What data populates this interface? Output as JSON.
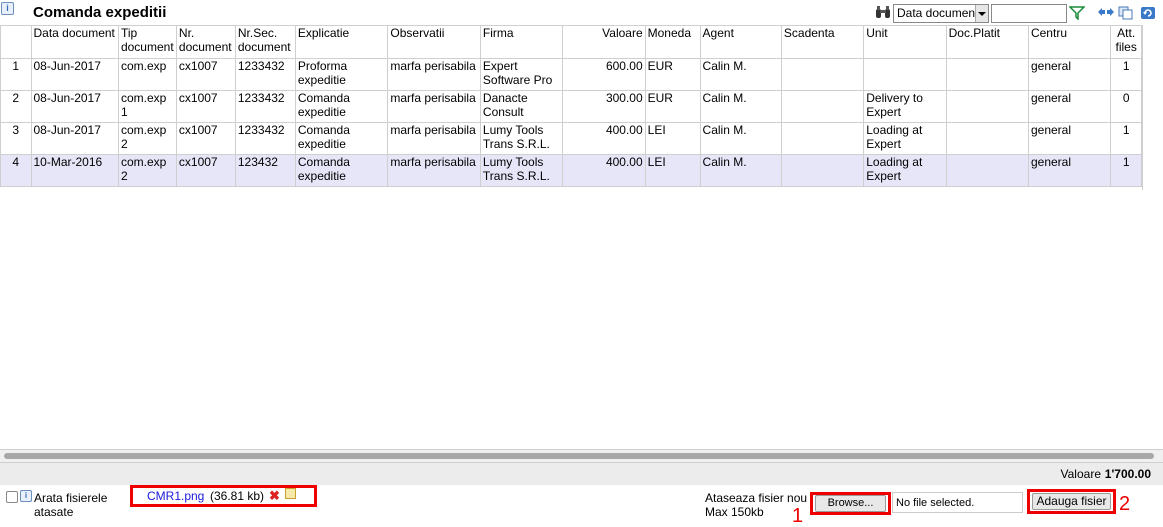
{
  "window": {
    "title": "Comanda expeditii"
  },
  "toolbar": {
    "sort_select_value": "Data documen",
    "search_value": "",
    "icons": [
      "binoculars-icon",
      "filter-icon",
      "expand-icon",
      "copy-icon",
      "refresh-icon"
    ]
  },
  "grid": {
    "columns": [
      {
        "label": "Data document"
      },
      {
        "label": "Tip document"
      },
      {
        "label": "Nr. document"
      },
      {
        "label": "Nr.Sec. document"
      },
      {
        "label": "Explicatie"
      },
      {
        "label": "Observatii"
      },
      {
        "label": "Firma"
      },
      {
        "label": "Valoare"
      },
      {
        "label": "Moneda"
      },
      {
        "label": "Agent"
      },
      {
        "label": "Scadenta"
      },
      {
        "label": "Unit"
      },
      {
        "label": "Doc.Platit"
      },
      {
        "label": "Centru"
      },
      {
        "label": "Att. files"
      }
    ],
    "rows": [
      {
        "n": "1",
        "data": "08-Jun-2017",
        "tip": "com.exp",
        "nr": "cx1007",
        "nrsec": "1233432",
        "explicatie": "Proforma expeditie",
        "observatii": "marfa perisabila",
        "firma": "Expert Software Pro",
        "valoare": "600.00",
        "moneda": "EUR",
        "agent": "Calin M.",
        "scadenta": "",
        "unit": "",
        "docplatit": "",
        "centru": "general",
        "att": "1"
      },
      {
        "n": "2",
        "data": "08-Jun-2017",
        "tip": "com.exp 1",
        "nr": "cx1007",
        "nrsec": "1233432",
        "explicatie": "Comanda expeditie",
        "observatii": "marfa perisabila",
        "firma": "Danacte Consult",
        "valoare": "300.00",
        "moneda": "EUR",
        "agent": "Calin M.",
        "scadenta": "",
        "unit": "Delivery to Expert",
        "docplatit": "",
        "centru": "general",
        "att": "0"
      },
      {
        "n": "3",
        "data": "08-Jun-2017",
        "tip": "com.exp 2",
        "nr": "cx1007",
        "nrsec": "1233432",
        "explicatie": "Comanda expeditie",
        "observatii": "marfa perisabila",
        "firma": "Lumy Tools Trans S.R.L.",
        "valoare": "400.00",
        "moneda": "LEI",
        "agent": "Calin M.",
        "scadenta": "",
        "unit": "Loading at Expert",
        "docplatit": "",
        "centru": "general",
        "att": "1"
      },
      {
        "n": "4",
        "data": "10-Mar-2016",
        "tip": "com.exp 2",
        "nr": "cx1007",
        "nrsec": "123432",
        "explicatie": "Comanda expeditie",
        "observatii": "marfa perisabila",
        "firma": "Lumy Tools Trans S.R.L.",
        "valoare": "400.00",
        "moneda": "LEI",
        "agent": "Calin M.",
        "scadenta": "",
        "unit": "Loading at Expert",
        "docplatit": "",
        "centru": "general",
        "att": "1"
      }
    ]
  },
  "totals": {
    "label": "Valoare",
    "value": "1'700.00"
  },
  "attachments": {
    "show_label": "Arata fisierele atasate",
    "file_name": "CMR1.png",
    "file_size": "(36.81 kb)",
    "attach_label_line1": "Ataseaza fisier nou",
    "attach_label_line2": "Max 150kb",
    "browse_label": "Browse...",
    "no_file_text": "No file selected.",
    "add_label": "Adauga fisier",
    "marker_1": "1",
    "marker_2": "2"
  },
  "colors": {
    "highlight": "#e00000",
    "selected_row": "#e6e6f8",
    "link": "#1a1adb"
  }
}
